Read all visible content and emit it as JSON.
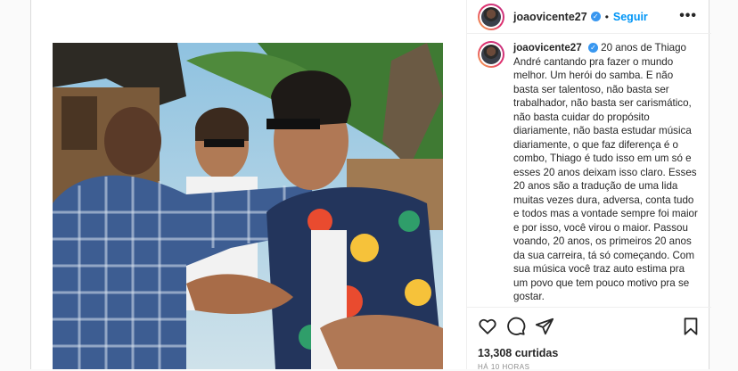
{
  "post": {
    "username": "joaovicente27",
    "verified_mark": "✓",
    "separator": "•",
    "follow_label": "Seguir",
    "more_label": "•••",
    "caption": "20 anos de Thiago André cantando pra fazer o mundo melhor. Um herói do samba. E não basta ser talentoso, não basta ser trabalhador, não basta ser carismático, não basta cuidar do propósito diariamente, não basta estudar música diariamente, o que faz diferença é o combo, Thiago é tudo isso em um só e esses 20 anos deixam isso claro. Esses 20 anos são a tradução de uma lida muitas vezes dura, adversa, conta tudo e todos mas a vontade sempre foi maior e por isso, você virou o maior. Passou voando, 20 anos, os primeiros 20 anos da sua carreira, tá só começando. Com sua música você traz auto estima pra um povo que tem pouco motivo pra se gostar.",
    "likes": "13,308 curtidas",
    "time": "HÁ 10 HORAS"
  },
  "icons": {
    "like": "heart-icon",
    "comment": "comment-icon",
    "share": "share-icon",
    "save": "bookmark-icon",
    "more": "more-icon",
    "verified": "verified-badge-icon"
  },
  "colors": {
    "accent": "#0095f6",
    "verified": "#3897f0",
    "text": "#262626",
    "muted": "#8e8e8e",
    "border": "#dbdbdb"
  }
}
